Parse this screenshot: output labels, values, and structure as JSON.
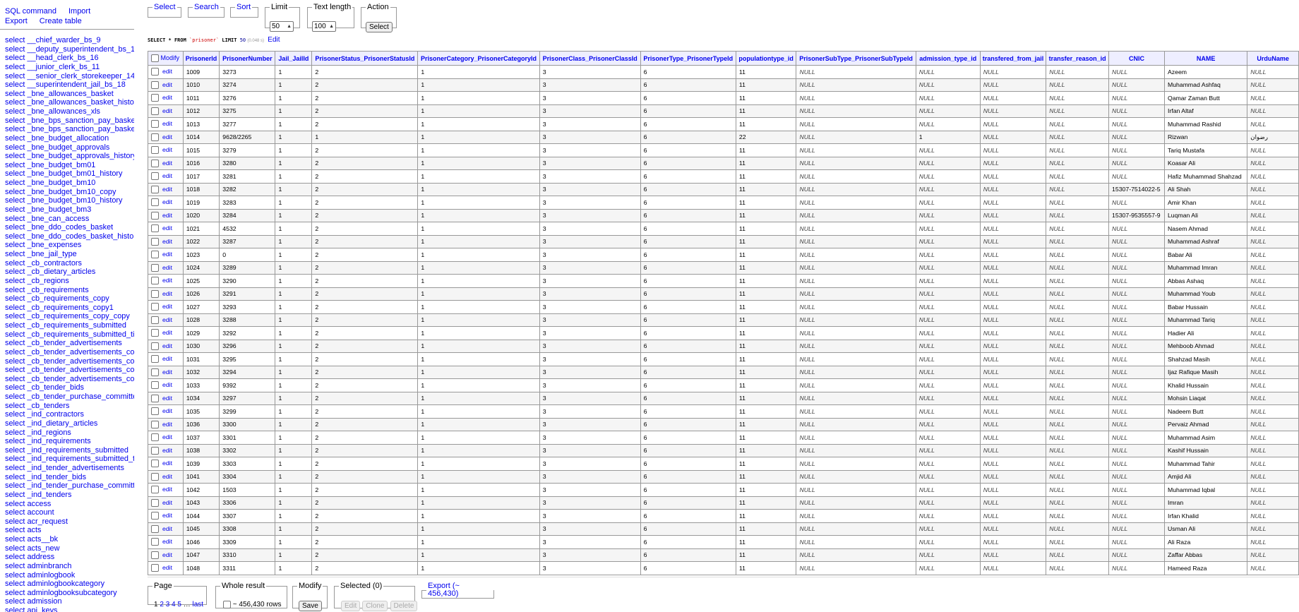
{
  "menu": {
    "links": [
      "SQL command",
      "Import",
      "Export",
      "Create table"
    ],
    "tables": [
      "select __chief_warder_bs_9",
      "select __deputy_superintendent_bs_17",
      "select __head_clerk_bs_16",
      "select __junior_clerk_bs_11",
      "select __senior_clerk_storekeeper_14",
      "select __superintendent_jail_bs_18",
      "select _bne_allowances_basket",
      "select _bne_allowances_basket_history",
      "select _bne_allowances_xls",
      "select _bne_bps_sanction_pay_basket",
      "select _bne_bps_sanction_pay_basket_l",
      "select _bne_budget_allocation",
      "select _bne_budget_approvals",
      "select _bne_budget_approvals_history",
      "select _bne_budget_bm01",
      "select _bne_budget_bm01_history",
      "select _bne_budget_bm10",
      "select _bne_budget_bm10_copy",
      "select _bne_budget_bm10_history",
      "select _bne_budget_bm3",
      "select _bne_can_access",
      "select _bne_ddo_codes_basket",
      "select _bne_ddo_codes_basket_history",
      "select _bne_expenses",
      "select _bne_jail_type",
      "select _cb_contractors",
      "select _cb_dietary_articles",
      "select _cb_regions",
      "select _cb_requirements",
      "select _cb_requirements_copy",
      "select _cb_requirements_copy1",
      "select _cb_requirements_copy_copy",
      "select _cb_requirements_submitted",
      "select _cb_requirements_submitted_time",
      "select _cb_tender_advertisements",
      "select _cb_tender_advertisements_copy",
      "select _cb_tender_advertisements_copy",
      "select _cb_tender_advertisements_copy",
      "select _cb_tender_advertisements_copy_",
      "select _cb_tender_bids",
      "select _cb_tender_purchase_committee",
      "select _cb_tenders",
      "select _ind_contractors",
      "select _ind_dietary_articles",
      "select _ind_regions",
      "select _ind_requirements",
      "select _ind_requirements_submitted",
      "select _ind_requirements_submitted_tim",
      "select _ind_tender_advertisements",
      "select _ind_tender_bids",
      "select _ind_tender_purchase_committee",
      "select _ind_tenders",
      "select access",
      "select account",
      "select acr_request",
      "select acts",
      "select acts__bk",
      "select acts_new",
      "select address",
      "select adminbranch",
      "select adminlogbook",
      "select adminlogbookcategory",
      "select adminlogbooksubcategory",
      "select admission",
      "select api_keys"
    ]
  },
  "top_fieldsets": {
    "select": "Select",
    "search": "Search",
    "sort": "Sort",
    "limit_label": "Limit",
    "limit_value": "50",
    "text_length_label": "Text length",
    "text_length_value": "100",
    "action_label": "Action",
    "action_button": "Select"
  },
  "sql": {
    "keyword_select": "SELECT",
    "star": "*",
    "keyword_from": "FROM",
    "table": "`prisoner`",
    "keyword_limit": "LIMIT",
    "limit": "50",
    "time": "(0.048 s)",
    "edit": "Edit"
  },
  "grid": {
    "modify_label": "Modify",
    "edit_label": "edit",
    "null_text": "NULL",
    "columns": [
      "PrisonerId",
      "PrisonerNumber",
      "Jail_JailId",
      "PrisonerStatus_PrisonerStatusId",
      "PrisonerCategory_PrisonerCategoryId",
      "PrisonerClass_PrisonerClassId",
      "PrisonerType_PrisonerTypeId",
      "populationtype_id",
      "PrisonerSubType_PrisonerSubTypeId",
      "admission_type_id",
      "transfered_from_jail",
      "transfer_reason_id",
      "CNIC",
      "NAME",
      "UrduName"
    ],
    "rows": [
      [
        "1009",
        "3273",
        "1",
        "2",
        "1",
        "3",
        "6",
        "11",
        "NULL",
        "NULL",
        "NULL",
        "NULL",
        "NULL",
        "Azeem",
        "NULL"
      ],
      [
        "1010",
        "3274",
        "1",
        "2",
        "1",
        "3",
        "6",
        "11",
        "NULL",
        "NULL",
        "NULL",
        "NULL",
        "NULL",
        "Muhammad Ashfaq",
        "NULL"
      ],
      [
        "1011",
        "3276",
        "1",
        "2",
        "1",
        "3",
        "6",
        "11",
        "NULL",
        "NULL",
        "NULL",
        "NULL",
        "NULL",
        "Qamar Zaman Butt",
        "NULL"
      ],
      [
        "1012",
        "3275",
        "1",
        "2",
        "1",
        "3",
        "6",
        "11",
        "NULL",
        "NULL",
        "NULL",
        "NULL",
        "NULL",
        "Irfan Altaf",
        "NULL"
      ],
      [
        "1013",
        "3277",
        "1",
        "2",
        "1",
        "3",
        "6",
        "11",
        "NULL",
        "NULL",
        "NULL",
        "NULL",
        "NULL",
        "Muhammad Rashid",
        "NULL"
      ],
      [
        "1014",
        "9628/2265",
        "1",
        "1",
        "1",
        "3",
        "6",
        "22",
        "NULL",
        "1",
        "NULL",
        "NULL",
        "NULL",
        "Rizwan",
        "رضوان"
      ],
      [
        "1015",
        "3279",
        "1",
        "2",
        "1",
        "3",
        "6",
        "11",
        "NULL",
        "NULL",
        "NULL",
        "NULL",
        "NULL",
        "Tariq Mustafa",
        "NULL"
      ],
      [
        "1016",
        "3280",
        "1",
        "2",
        "1",
        "3",
        "6",
        "11",
        "NULL",
        "NULL",
        "NULL",
        "NULL",
        "NULL",
        "Koasar Ali",
        "NULL"
      ],
      [
        "1017",
        "3281",
        "1",
        "2",
        "1",
        "3",
        "6",
        "11",
        "NULL",
        "NULL",
        "NULL",
        "NULL",
        "NULL",
        "Hafiz Muhammad Shahzad",
        "NULL"
      ],
      [
        "1018",
        "3282",
        "1",
        "2",
        "1",
        "3",
        "6",
        "11",
        "NULL",
        "NULL",
        "NULL",
        "NULL",
        "15307-7514022-5",
        "Ali Shah",
        "NULL"
      ],
      [
        "1019",
        "3283",
        "1",
        "2",
        "1",
        "3",
        "6",
        "11",
        "NULL",
        "NULL",
        "NULL",
        "NULL",
        "NULL",
        "Amir Khan",
        "NULL"
      ],
      [
        "1020",
        "3284",
        "1",
        "2",
        "1",
        "3",
        "6",
        "11",
        "NULL",
        "NULL",
        "NULL",
        "NULL",
        "15307-9535557-9",
        "Luqman Ali",
        "NULL"
      ],
      [
        "1021",
        "4532",
        "1",
        "2",
        "1",
        "3",
        "6",
        "11",
        "NULL",
        "NULL",
        "NULL",
        "NULL",
        "NULL",
        "Nasem Ahmad",
        "NULL"
      ],
      [
        "1022",
        "3287",
        "1",
        "2",
        "1",
        "3",
        "6",
        "11",
        "NULL",
        "NULL",
        "NULL",
        "NULL",
        "NULL",
        "Muhammad Ashraf",
        "NULL"
      ],
      [
        "1023",
        "0",
        "1",
        "2",
        "1",
        "3",
        "6",
        "11",
        "NULL",
        "NULL",
        "NULL",
        "NULL",
        "NULL",
        "Babar Ali",
        "NULL"
      ],
      [
        "1024",
        "3289",
        "1",
        "2",
        "1",
        "3",
        "6",
        "11",
        "NULL",
        "NULL",
        "NULL",
        "NULL",
        "NULL",
        "Muhammad Imran",
        "NULL"
      ],
      [
        "1025",
        "3290",
        "1",
        "2",
        "1",
        "3",
        "6",
        "11",
        "NULL",
        "NULL",
        "NULL",
        "NULL",
        "NULL",
        "Abbas Ashaq",
        "NULL"
      ],
      [
        "1026",
        "3291",
        "1",
        "2",
        "1",
        "3",
        "6",
        "11",
        "NULL",
        "NULL",
        "NULL",
        "NULL",
        "NULL",
        "Muhammad Youb",
        "NULL"
      ],
      [
        "1027",
        "3293",
        "1",
        "2",
        "1",
        "3",
        "6",
        "11",
        "NULL",
        "NULL",
        "NULL",
        "NULL",
        "NULL",
        "Babar Hussain",
        "NULL"
      ],
      [
        "1028",
        "3288",
        "1",
        "2",
        "1",
        "3",
        "6",
        "11",
        "NULL",
        "NULL",
        "NULL",
        "NULL",
        "NULL",
        "Muhammad Tariq",
        "NULL"
      ],
      [
        "1029",
        "3292",
        "1",
        "2",
        "1",
        "3",
        "6",
        "11",
        "NULL",
        "NULL",
        "NULL",
        "NULL",
        "NULL",
        "Hadier Ali",
        "NULL"
      ],
      [
        "1030",
        "3296",
        "1",
        "2",
        "1",
        "3",
        "6",
        "11",
        "NULL",
        "NULL",
        "NULL",
        "NULL",
        "NULL",
        "Mehboob Ahmad",
        "NULL"
      ],
      [
        "1031",
        "3295",
        "1",
        "2",
        "1",
        "3",
        "6",
        "11",
        "NULL",
        "NULL",
        "NULL",
        "NULL",
        "NULL",
        "Shahzad Masih",
        "NULL"
      ],
      [
        "1032",
        "3294",
        "1",
        "2",
        "1",
        "3",
        "6",
        "11",
        "NULL",
        "NULL",
        "NULL",
        "NULL",
        "NULL",
        "Ijaz Rafique Masih",
        "NULL"
      ],
      [
        "1033",
        "9392",
        "1",
        "2",
        "1",
        "3",
        "6",
        "11",
        "NULL",
        "NULL",
        "NULL",
        "NULL",
        "NULL",
        "Khalid Hussain",
        "NULL"
      ],
      [
        "1034",
        "3297",
        "1",
        "2",
        "1",
        "3",
        "6",
        "11",
        "NULL",
        "NULL",
        "NULL",
        "NULL",
        "NULL",
        "Mohsin Liaqat",
        "NULL"
      ],
      [
        "1035",
        "3299",
        "1",
        "2",
        "1",
        "3",
        "6",
        "11",
        "NULL",
        "NULL",
        "NULL",
        "NULL",
        "NULL",
        "Nadeem Butt",
        "NULL"
      ],
      [
        "1036",
        "3300",
        "1",
        "2",
        "1",
        "3",
        "6",
        "11",
        "NULL",
        "NULL",
        "NULL",
        "NULL",
        "NULL",
        "Pervaiz Ahmad",
        "NULL"
      ],
      [
        "1037",
        "3301",
        "1",
        "2",
        "1",
        "3",
        "6",
        "11",
        "NULL",
        "NULL",
        "NULL",
        "NULL",
        "NULL",
        "Muhammad Asim",
        "NULL"
      ],
      [
        "1038",
        "3302",
        "1",
        "2",
        "1",
        "3",
        "6",
        "11",
        "NULL",
        "NULL",
        "NULL",
        "NULL",
        "NULL",
        "Kashif Hussain",
        "NULL"
      ],
      [
        "1039",
        "3303",
        "1",
        "2",
        "1",
        "3",
        "6",
        "11",
        "NULL",
        "NULL",
        "NULL",
        "NULL",
        "NULL",
        "Muhammad Tahir",
        "NULL"
      ],
      [
        "1041",
        "3304",
        "1",
        "2",
        "1",
        "3",
        "6",
        "11",
        "NULL",
        "NULL",
        "NULL",
        "NULL",
        "NULL",
        "Amjid Ali",
        "NULL"
      ],
      [
        "1042",
        "1503",
        "1",
        "2",
        "1",
        "3",
        "6",
        "11",
        "NULL",
        "NULL",
        "NULL",
        "NULL",
        "NULL",
        "Muhammad Iqbal",
        "NULL"
      ],
      [
        "1043",
        "3306",
        "1",
        "2",
        "1",
        "3",
        "6",
        "11",
        "NULL",
        "NULL",
        "NULL",
        "NULL",
        "NULL",
        "Imran",
        "NULL"
      ],
      [
        "1044",
        "3307",
        "1",
        "2",
        "1",
        "3",
        "6",
        "11",
        "NULL",
        "NULL",
        "NULL",
        "NULL",
        "NULL",
        "Irfan Khalid",
        "NULL"
      ],
      [
        "1045",
        "3308",
        "1",
        "2",
        "1",
        "3",
        "6",
        "11",
        "NULL",
        "NULL",
        "NULL",
        "NULL",
        "NULL",
        "Usman Ali",
        "NULL"
      ],
      [
        "1046",
        "3309",
        "1",
        "2",
        "1",
        "3",
        "6",
        "11",
        "NULL",
        "NULL",
        "NULL",
        "NULL",
        "NULL",
        "Ali Raza",
        "NULL"
      ],
      [
        "1047",
        "3310",
        "1",
        "2",
        "1",
        "3",
        "6",
        "11",
        "NULL",
        "NULL",
        "NULL",
        "NULL",
        "NULL",
        "Zaffar Abbas",
        "NULL"
      ],
      [
        "1048",
        "3311",
        "1",
        "2",
        "1",
        "3",
        "6",
        "11",
        "NULL",
        "NULL",
        "NULL",
        "NULL",
        "NULL",
        "Hameed Raza",
        "NULL"
      ]
    ]
  },
  "bottom": {
    "page_label": "Page",
    "pages": [
      "1",
      "2",
      "3",
      "4",
      "5"
    ],
    "ellipsis": "…",
    "last": "last",
    "whole_label": "Whole result",
    "rows_text": "~ 456,430 rows",
    "modify_label": "Modify",
    "save": "Save",
    "selected_label": "Selected (0)",
    "edit": "Edit",
    "clone": "Clone",
    "delete": "Delete",
    "export": "Export (~ 456,430)"
  },
  "colors": {
    "link": "#0000ee",
    "header_bg": "#eeeeff",
    "odd_row_bg": "#f5f5f5",
    "border": "#999999"
  }
}
